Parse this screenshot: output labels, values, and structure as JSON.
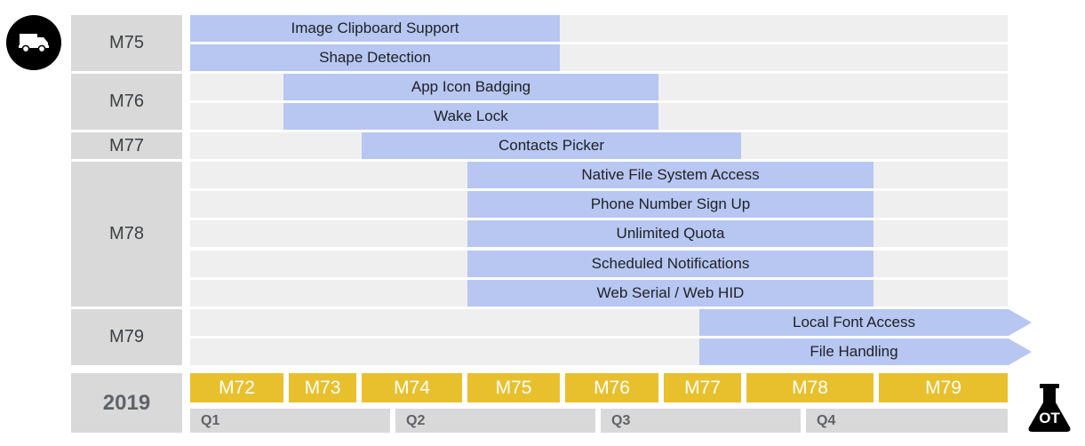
{
  "milestone_groups": [
    {
      "label": "M75"
    },
    {
      "label": "M76"
    },
    {
      "label": "M77"
    },
    {
      "label": "M78"
    },
    {
      "label": "M79"
    }
  ],
  "features": [
    {
      "name": "Image Clipboard Support"
    },
    {
      "name": "Shape Detection"
    },
    {
      "name": "App Icon Badging"
    },
    {
      "name": "Wake Lock"
    },
    {
      "name": "Contacts Picker"
    },
    {
      "name": "Native File System Access"
    },
    {
      "name": "Phone Number Sign Up"
    },
    {
      "name": "Unlimited Quota"
    },
    {
      "name": "Scheduled Notifications"
    },
    {
      "name": "Web Serial / Web HID"
    },
    {
      "name": "Local Font Access"
    },
    {
      "name": "File Handling"
    }
  ],
  "timeline": {
    "year": "2019",
    "milestones": [
      "M72",
      "M73",
      "M74",
      "M75",
      "M76",
      "M77",
      "M78",
      "M79"
    ],
    "quarters": [
      "Q1",
      "Q2",
      "Q3",
      "Q4"
    ]
  },
  "icons": {
    "shipping": "truck-icon",
    "origin_trial": "flask-icon",
    "origin_trial_text": "OT"
  },
  "colors": {
    "feature_bar": "#b7c7f2",
    "milestone_bar": "#e8c02e",
    "label_bg": "#d9d9d9",
    "track_bg": "#efefef"
  }
}
